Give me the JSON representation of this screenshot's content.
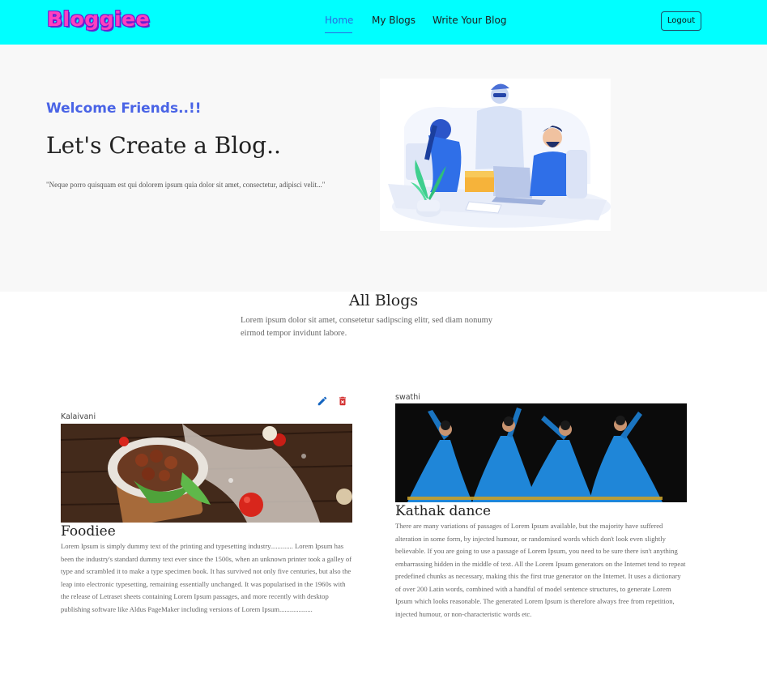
{
  "header": {
    "logo": "Bloggiee",
    "nav": [
      {
        "label": "Home",
        "active": true
      },
      {
        "label": "My Blogs",
        "active": false
      },
      {
        "label": "Write Your Blog",
        "active": false
      }
    ],
    "logout_label": "Logout",
    "bg_color": "#00ffff",
    "accent_color": "#2b6be0"
  },
  "hero": {
    "welcome": "Welcome Friends..!!",
    "title": "Let's Create a Blog..",
    "quote": "\"Neque porro quisquam est qui dolorem ipsum quia dolor sit amet, consectetur, adipisci velit...\"",
    "welcome_color": "#4a64e6"
  },
  "all_blogs": {
    "title": "All Blogs",
    "description": "Lorem ipsum dolor sit amet, consetetur sadipscing elitr, sed diam nonumy eirmod tempor invidunt labore."
  },
  "blogs": [
    {
      "author": "Kalaivani",
      "title": "Foodiee",
      "description": "Lorem Ipsum is simply dummy text of the printing and typesetting industry............. Lorem Ipsum has been the industry's standard dummy text ever since the 1500s, when an unknown printer took a galley of type and scrambled it to make a type specimen book. It has survived not only five centuries, but also the leap into electronic typesetting, remaining essentially unchanged. It was popularised in the 1960s with the release of Letraset sheets containing Lorem Ipsum passages, and more recently with desktop publishing software like Aldus PageMaker including versions of Lorem Ipsum...................",
      "icons": {
        "edit": "edit-icon",
        "delete": "delete-icon"
      },
      "edit_color": "#1565c0",
      "delete_color": "#d32f2f"
    },
    {
      "author": "swathi",
      "title": "Kathak dance",
      "description": "There are many variations of passages of Lorem Ipsum available, but the majority have suffered alteration in some form, by injected humour, or randomised words which don't look even slightly believable. If you are going to use a passage of Lorem Ipsum, you need to be sure there isn't anything embarrassing hidden in the middle of text. All the Lorem Ipsum generators on the Internet tend to repeat predefined chunks as necessary, making this the first true generator on the Internet. It uses a dictionary of over 200 Latin words, combined with a handful of model sentence structures, to generate Lorem Ipsum which looks reasonable. The generated Lorem Ipsum is therefore always free from repetition, injected humour, or non-characteristic words etc."
    }
  ]
}
